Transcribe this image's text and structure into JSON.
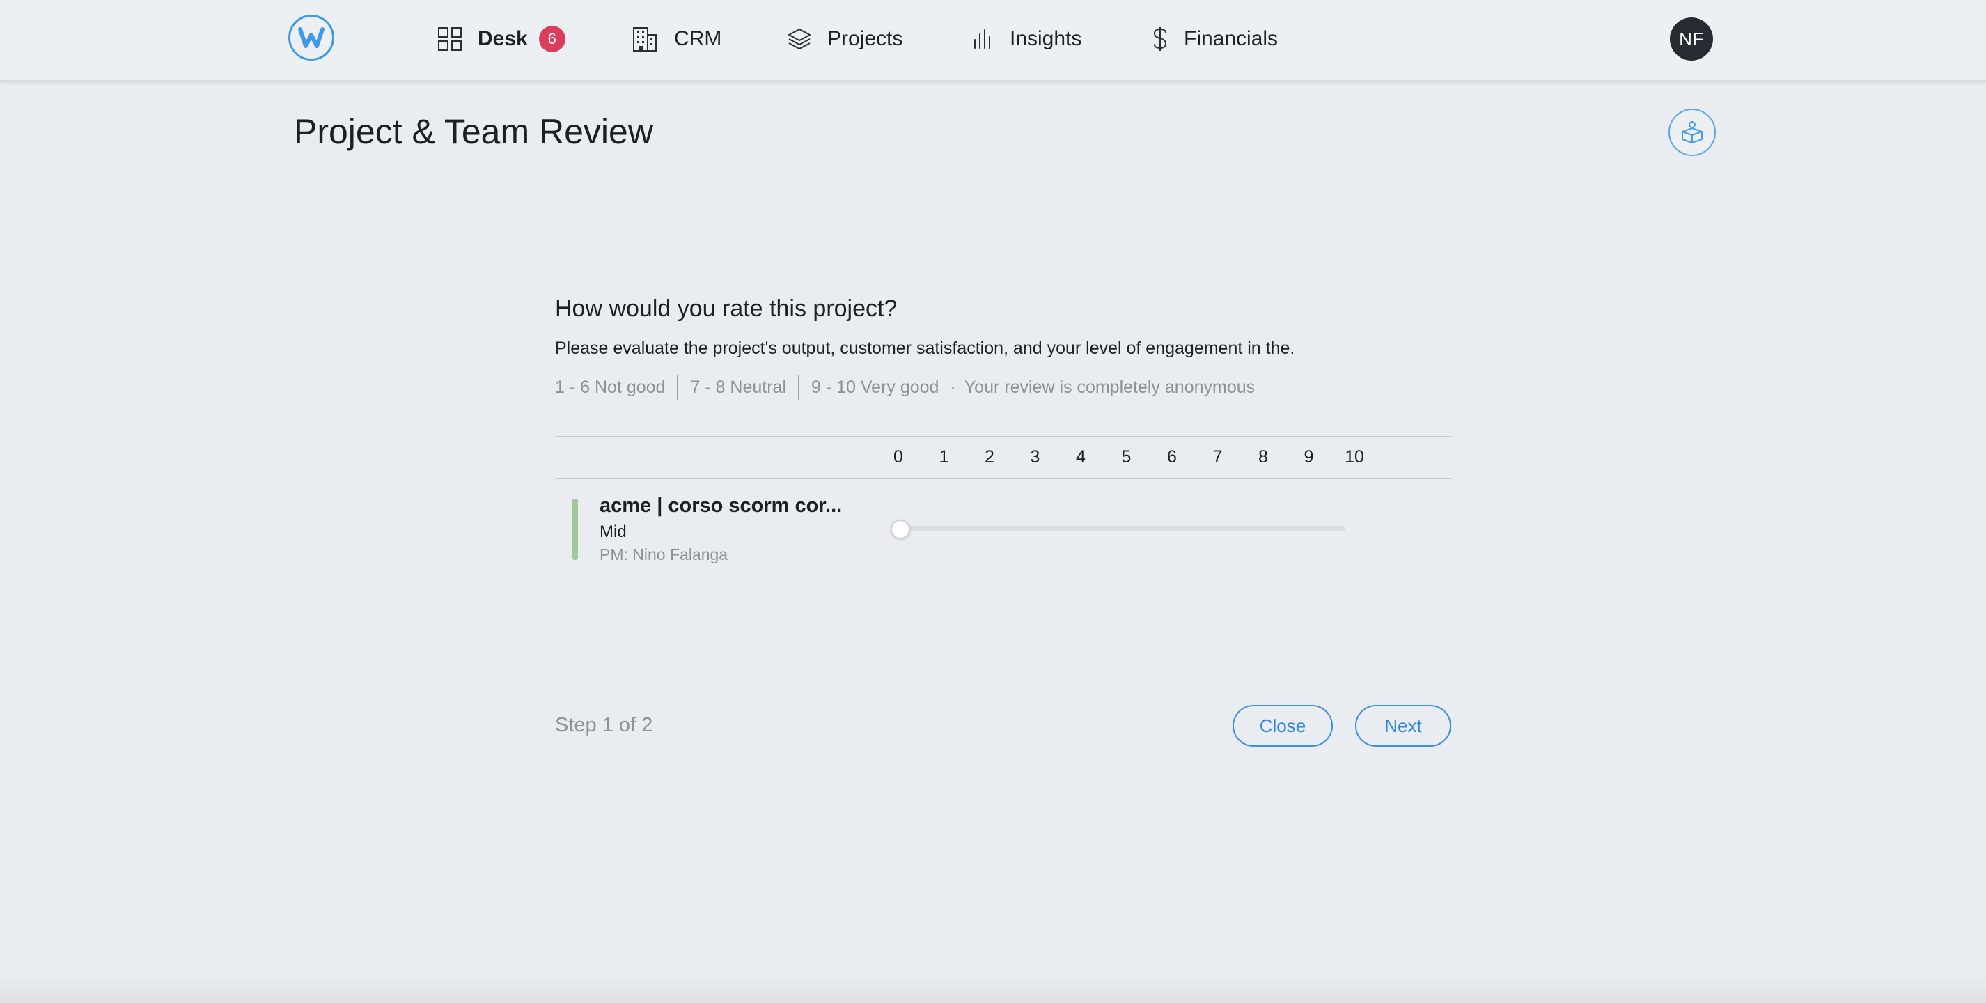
{
  "nav": {
    "logo_letter": "W",
    "items": [
      {
        "label": "Desk",
        "icon": "grid-icon",
        "badge": "6"
      },
      {
        "label": "CRM",
        "icon": "building-icon"
      },
      {
        "label": "Projects",
        "icon": "layers-icon"
      },
      {
        "label": "Insights",
        "icon": "bar-chart-icon"
      },
      {
        "label": "Financials",
        "icon": "dollar-icon"
      }
    ],
    "avatar_initials": "NF"
  },
  "page": {
    "title": "Project & Team Review",
    "header_action_icon": "box-icon"
  },
  "survey": {
    "question": "How would you rate this project?",
    "description": "Please evaluate the project's output, customer satisfaction, and your level of engagement in the.",
    "legend": {
      "low": "1 - 6 Not good",
      "mid": "7 - 8 Neutral",
      "high": "9 - 10 Very good",
      "dot": "·",
      "note": "Your review is completely anonymous"
    },
    "scale": [
      "0",
      "1",
      "2",
      "3",
      "4",
      "5",
      "6",
      "7",
      "8",
      "9",
      "10"
    ],
    "project": {
      "name": "acme | corso scorm cor...",
      "level": "Mid",
      "pm": "PM: Nino Falanga",
      "rating": 0,
      "accent_color": "#a3c89a"
    },
    "step": "Step 1 of 2",
    "buttons": {
      "close": "Close",
      "next": "Next"
    }
  },
  "colors": {
    "accent": "#2f86dc",
    "badge": "#dc3d5c",
    "background": "#e9ecf0"
  }
}
